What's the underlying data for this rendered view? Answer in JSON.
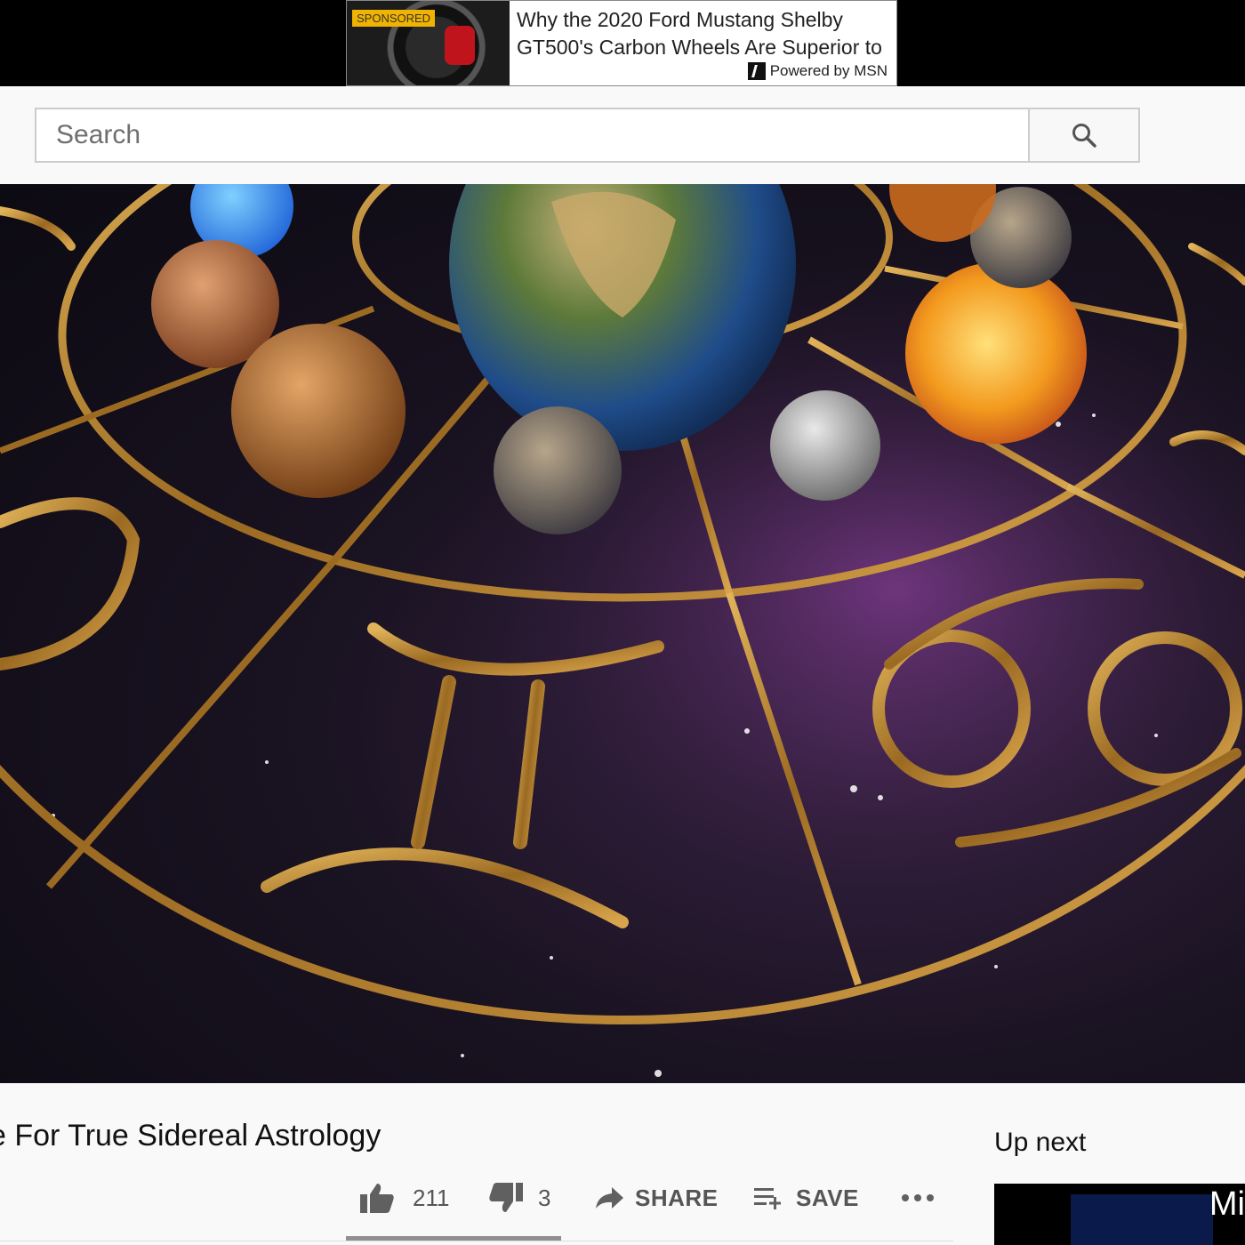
{
  "ad": {
    "badge": "SPONSORED",
    "headline": "Why the 2020 Ford Mustang Shelby GT500's Carbon Wheels Are Superior to",
    "powered_by": "Powered by MSN"
  },
  "search": {
    "placeholder": "Search"
  },
  "video": {
    "title": "e For True Sidereal Astrology",
    "likes": "211",
    "dislikes": "3",
    "share_label": "SHARE",
    "save_label": "SAVE"
  },
  "sidebar": {
    "up_next_label": "Up next",
    "next_thumb_text": "Mi"
  },
  "colors": {
    "gold": "#b8862e",
    "space": "#1a1322"
  }
}
